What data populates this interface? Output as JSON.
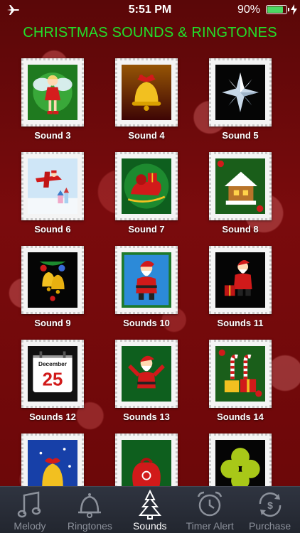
{
  "status": {
    "time": "5:51 PM",
    "battery_percent": "90%",
    "battery_level": 0.9,
    "icons": [
      "airplane-icon",
      "battery-icon",
      "charging-bolt-icon"
    ]
  },
  "title": "CHRISTMAS SOUNDS & RINGTONES",
  "colors": {
    "title_green": "#22e02a",
    "background_red": "#6a0708",
    "battery_green": "#4cd964",
    "tab_inactive": "#8c919b",
    "tab_active": "#ffffff"
  },
  "sounds": [
    {
      "label": "Sound 3",
      "icon": "fairy-icon"
    },
    {
      "label": "Sound 4",
      "icon": "golden-bell-icon"
    },
    {
      "label": "Sound 5",
      "icon": "silver-star-icon"
    },
    {
      "label": "Sound 6",
      "icon": "santa-plane-icon"
    },
    {
      "label": "Sound 7",
      "icon": "sleigh-icon"
    },
    {
      "label": "Sound 8",
      "icon": "snowy-house-icon"
    },
    {
      "label": "Sound 9",
      "icon": "bells-ornament-icon"
    },
    {
      "label": "Sounds 10",
      "icon": "santa-icon"
    },
    {
      "label": "Sounds 11",
      "icon": "santa-gifts-icon"
    },
    {
      "label": "Sounds 12",
      "icon": "calendar-icon"
    },
    {
      "label": "Sounds 13",
      "icon": "santa-waving-icon"
    },
    {
      "label": "Sounds 14",
      "icon": "candy-gifts-icon"
    },
    {
      "label": "",
      "icon": "blue-bell-icon"
    },
    {
      "label": "",
      "icon": "gift-sack-icon"
    },
    {
      "label": "",
      "icon": "green-clover-icon"
    }
  ],
  "calendar": {
    "month": "December",
    "day": "25"
  },
  "tabs": [
    {
      "label": "Melody",
      "icon": "music-note-icon",
      "active": false
    },
    {
      "label": "Ringtones",
      "icon": "bell-icon",
      "active": false
    },
    {
      "label": "Sounds",
      "icon": "christmas-tree-icon",
      "active": true
    },
    {
      "label": "Timer Alert",
      "icon": "alarm-clock-icon",
      "active": false
    },
    {
      "label": "Purchase",
      "icon": "dollar-refresh-icon",
      "active": false
    }
  ]
}
